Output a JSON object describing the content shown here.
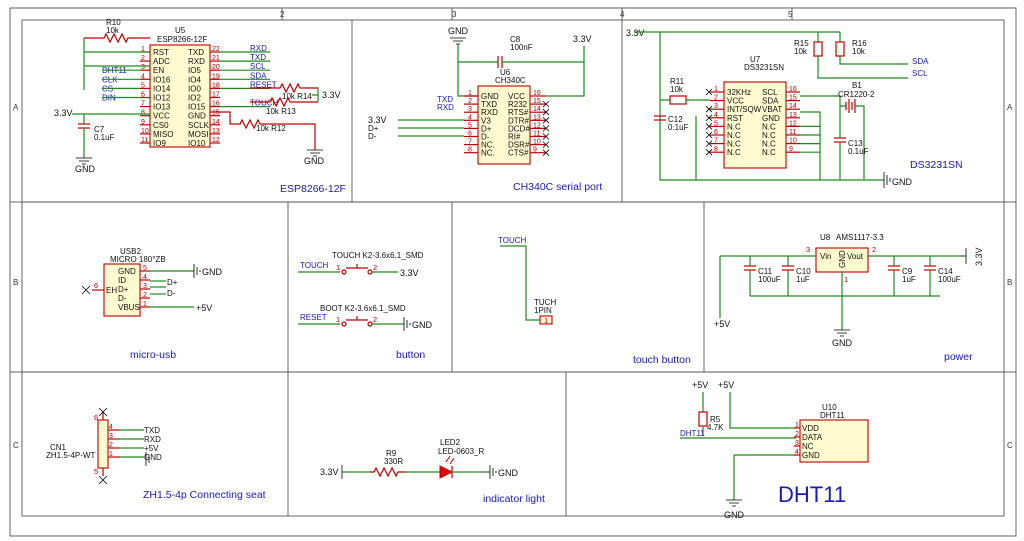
{
  "sheet": {
    "columns": [
      "2",
      "3",
      "4",
      "5"
    ],
    "rows": [
      "A",
      "B",
      "C"
    ]
  },
  "sections": {
    "esp": "ESP8266-12F",
    "ch340": "CH340C serial port",
    "rtc": "DS3231SN",
    "usb": "micro-usb",
    "button": "button",
    "touch": "touch button",
    "power": "power",
    "zh": "ZH1.5-4p Connecting seat",
    "led": "indicator light",
    "dht": "DHT11"
  },
  "u5": {
    "ref": "U5",
    "part": "ESP8266-12F",
    "left_pins": [
      "RST",
      "ADC",
      "EN",
      "IO16",
      "IO14",
      "IO12",
      "IO13",
      "VCC",
      "CS0",
      "MISO",
      "IO9"
    ],
    "left_nums": [
      "1",
      "2",
      "3",
      "4",
      "5",
      "6",
      "7",
      "8",
      "9",
      "10",
      "11"
    ],
    "right_pins": [
      "TXD",
      "RXD",
      "IO5",
      "IO4",
      "IO0",
      "IO2",
      "IO15",
      "GND",
      "SCLK",
      "MOSI",
      "IO10"
    ],
    "right_nums": [
      "22",
      "21",
      "20",
      "19",
      "18",
      "17",
      "16",
      "15",
      "14",
      "13",
      "12"
    ],
    "left_nets": [
      "",
      "",
      "DHT11",
      "CLK",
      "CS",
      "DIN",
      "",
      "",
      "",
      "",
      ""
    ],
    "right_nets": [
      "RXD",
      "TXD",
      "SCL",
      "SDA",
      "RESET",
      "",
      "TOUCH",
      "",
      "",
      "",
      ""
    ],
    "r10_ref": "R10",
    "r10_val": "10k",
    "r14_ref": "R14",
    "r14_val": "10k",
    "r13_ref": "R13",
    "r13_val": "10k",
    "r12_ref": "R12",
    "r12_val": "10k",
    "c7_ref": "C7",
    "c7_val": "0.1uF",
    "vcc_net": "3.3V",
    "gnd": "GND",
    "r_rail": "3.3V"
  },
  "u6": {
    "ref": "U6",
    "part": "CH340C",
    "left_pins": [
      "GND",
      "TXD",
      "RXD",
      "V3",
      "D+",
      "D-",
      "NC.",
      "NC."
    ],
    "left_nums": [
      "1",
      "2",
      "3",
      "4",
      "5",
      "6",
      "7",
      "8"
    ],
    "right_pins": [
      "VCC",
      "R232",
      "RTS#",
      "DTR#",
      "DCD#",
      "RI#",
      "DSR#",
      "CTS#"
    ],
    "right_nums": [
      "16",
      "15",
      "14",
      "13",
      "12",
      "11",
      "10",
      "9"
    ],
    "nets_left": [
      "TXD",
      "RXD",
      "3.3V",
      "D+",
      "D-"
    ],
    "c8_ref": "C8",
    "c8_val": "100nF",
    "gnd": "GND",
    "vcc": "3.3V"
  },
  "u7": {
    "ref": "U7",
    "part": "DS3231SN",
    "left_pins": [
      "32KHz",
      "VCC",
      "INT/SQW",
      "RST",
      "N.C",
      "N.C",
      "N.C",
      "N.C"
    ],
    "left_nums": [
      "1",
      "2",
      "3",
      "4",
      "5",
      "6",
      "7",
      "8"
    ],
    "right_pins": [
      "SCL",
      "SDA",
      "VBAT",
      "GND",
      "N.C",
      "N.C",
      "N.C",
      "N.C"
    ],
    "right_nums": [
      "16",
      "15",
      "14",
      "13",
      "12",
      "11",
      "10",
      "9"
    ],
    "r11_ref": "R11",
    "r11_val": "10k",
    "r15_ref": "R15",
    "r15_val": "10k",
    "r16_ref": "R16",
    "r16_val": "10k",
    "c12_ref": "C12",
    "c12_val": "0.1uF",
    "c13_ref": "C13",
    "c13_val": "0.1uF",
    "b1_ref": "B1",
    "b1_val": "CR1220-2",
    "vcc": "3.3V",
    "sda": "SDA",
    "scl": "SCL",
    "gnd": "GND"
  },
  "usb2": {
    "ref": "USB2",
    "part": "MICRO 180°ZB",
    "pins": [
      "GND",
      "ID",
      "D+",
      "D-",
      "VBUS"
    ],
    "nums": [
      "5",
      "4",
      "3",
      "2",
      "1"
    ],
    "eh": "EH",
    "eh_num": "6",
    "gnd": "GND",
    "dp": "D+",
    "dm": "D-",
    "v5": "+5V"
  },
  "buttons": {
    "touch_title": "TOUCH  K2-3.6x6.1_SMD",
    "touch_net": "TOUCH",
    "touch_rail": "3.3V",
    "boot_title": "BOOT  K2-3.6x6.1_SMD",
    "reset_net": "RESET",
    "gnd": "GND",
    "pin1": "1",
    "pin2": "2"
  },
  "touch": {
    "net": "TOUCH",
    "ref": "TUCH",
    "part": "1PIN",
    "pin": "1"
  },
  "u8": {
    "ref": "U8",
    "part": "AMS1117-3.3",
    "vin": "Vin",
    "vout": "Vout",
    "gnd": "GND",
    "pin_in": "3",
    "pin_out": "2",
    "pin_gnd": "1",
    "caps": [
      {
        "ref": "C11",
        "val": "100uF"
      },
      {
        "ref": "C10",
        "val": "1uF"
      },
      {
        "ref": "C9",
        "val": "1uF"
      },
      {
        "ref": "C14",
        "val": "100uF"
      }
    ],
    "v5": "+5V",
    "v33": "3.3V",
    "gnd_label": "GND"
  },
  "cn1": {
    "ref": "CN1",
    "part": "ZH1.5-4P-WT",
    "nums": [
      "4",
      "3",
      "2",
      "1"
    ],
    "nets": [
      "TXD",
      "RXD",
      "+5V",
      "GND"
    ],
    "shield": [
      "6",
      "5"
    ]
  },
  "led": {
    "r9_ref": "R9",
    "r9_val": "330R",
    "led_ref": "LED2",
    "led_part": "LED-0603_R",
    "vcc": "3.3V",
    "gnd": "GND"
  },
  "u10": {
    "ref": "U10",
    "part": "DHT11",
    "pins": [
      "VDD",
      "DATA",
      "NC",
      "GND"
    ],
    "nums": [
      "1",
      "2",
      "3",
      "4"
    ],
    "r5_ref": "R5",
    "r5_val": "4.7K",
    "net": "DHT11",
    "v5a": "+5V",
    "v5b": "+5V",
    "gnd": "GND"
  }
}
